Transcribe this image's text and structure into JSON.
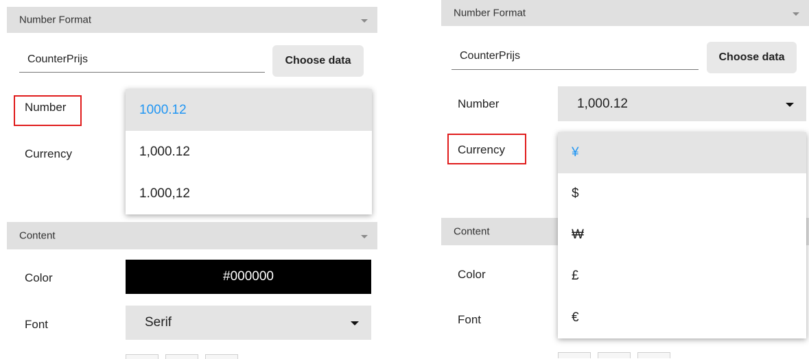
{
  "left": {
    "number_format_header": "Number Format",
    "field_name": "CounterPrijs",
    "choose_data_label": "Choose data",
    "number_label": "Number",
    "currency_label": "Currency",
    "number_options": [
      "1000.12",
      "1,000.12",
      "1.000,12"
    ],
    "number_selected": "1000.12",
    "content_header": "Content",
    "color_label": "Color",
    "color_value": "#000000",
    "font_label": "Font",
    "font_value": "Serif"
  },
  "right": {
    "number_format_header": "Number Format",
    "field_name": "CounterPrijs",
    "choose_data_label": "Choose data",
    "number_label": "Number",
    "number_value": "1,000.12",
    "currency_label": "Currency",
    "currency_options": [
      "¥",
      "$",
      "₩",
      "£",
      "€"
    ],
    "currency_selected": "¥",
    "content_header": "Content",
    "color_label": "Color",
    "font_label": "Font"
  },
  "colors": {
    "highlight": "#e01b1b",
    "selected_option_text": "#2196f3",
    "header_bg": "#e0e0e0"
  }
}
